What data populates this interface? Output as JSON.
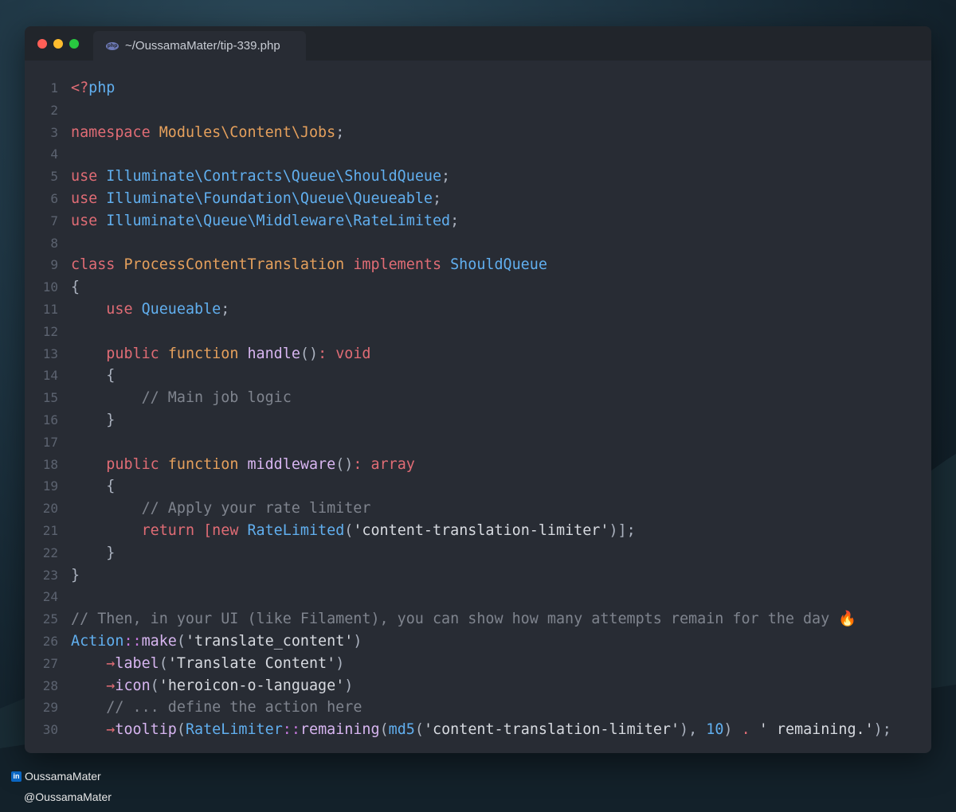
{
  "window": {
    "tab_title": "~/OussamaMater/tip-339.php",
    "tab_icon": "php-file-icon"
  },
  "code_lines": [
    {
      "n": "1",
      "tokens": [
        [
          "kw",
          "<?"
        ],
        [
          "ns",
          "php"
        ]
      ]
    },
    {
      "n": "2",
      "tokens": []
    },
    {
      "n": "3",
      "tokens": [
        [
          "kw",
          "namespace "
        ],
        [
          "cls",
          "Modules\\Content\\Jobs"
        ],
        [
          "pun",
          ";"
        ]
      ]
    },
    {
      "n": "4",
      "tokens": []
    },
    {
      "n": "5",
      "tokens": [
        [
          "kw",
          "use "
        ],
        [
          "ns",
          "Illuminate\\Contracts\\Queue\\ShouldQueue"
        ],
        [
          "pun",
          ";"
        ]
      ]
    },
    {
      "n": "6",
      "tokens": [
        [
          "kw",
          "use "
        ],
        [
          "ns",
          "Illuminate\\Foundation\\Queue\\Queueable"
        ],
        [
          "pun",
          ";"
        ]
      ]
    },
    {
      "n": "7",
      "tokens": [
        [
          "kw",
          "use "
        ],
        [
          "ns",
          "Illuminate\\Queue\\Middleware\\RateLimited"
        ],
        [
          "pun",
          ";"
        ]
      ]
    },
    {
      "n": "8",
      "tokens": []
    },
    {
      "n": "9",
      "tokens": [
        [
          "kw",
          "class "
        ],
        [
          "cls",
          "ProcessContentTranslation "
        ],
        [
          "kw",
          "implements "
        ],
        [
          "ns",
          "ShouldQueue"
        ]
      ]
    },
    {
      "n": "10",
      "tokens": [
        [
          "pun",
          "{"
        ]
      ]
    },
    {
      "n": "11",
      "tokens": [
        [
          "pun",
          "    "
        ],
        [
          "kw",
          "use "
        ],
        [
          "ns",
          "Queueable"
        ],
        [
          "pun",
          ";"
        ]
      ]
    },
    {
      "n": "12",
      "tokens": []
    },
    {
      "n": "13",
      "tokens": [
        [
          "pun",
          "    "
        ],
        [
          "kw",
          "public "
        ],
        [
          "cls",
          "function "
        ],
        [
          "fn",
          "handle"
        ],
        [
          "pun",
          "()"
        ],
        [
          "kw",
          ": void"
        ]
      ]
    },
    {
      "n": "14",
      "tokens": [
        [
          "pun",
          "    {"
        ]
      ]
    },
    {
      "n": "15",
      "tokens": [
        [
          "pun",
          "        "
        ],
        [
          "cm",
          "// Main job logic"
        ]
      ]
    },
    {
      "n": "16",
      "tokens": [
        [
          "pun",
          "    }"
        ]
      ]
    },
    {
      "n": "17",
      "tokens": []
    },
    {
      "n": "18",
      "tokens": [
        [
          "pun",
          "    "
        ],
        [
          "kw",
          "public "
        ],
        [
          "cls",
          "function "
        ],
        [
          "fn",
          "middleware"
        ],
        [
          "pun",
          "()"
        ],
        [
          "kw",
          ": array"
        ]
      ]
    },
    {
      "n": "19",
      "tokens": [
        [
          "pun",
          "    {"
        ]
      ]
    },
    {
      "n": "20",
      "tokens": [
        [
          "pun",
          "        "
        ],
        [
          "cm",
          "// Apply your rate limiter"
        ]
      ]
    },
    {
      "n": "21",
      "tokens": [
        [
          "pun",
          "        "
        ],
        [
          "kw",
          "return "
        ],
        [
          "kw",
          "["
        ],
        [
          "kw",
          "new "
        ],
        [
          "ns",
          "RateLimited"
        ],
        [
          "pun",
          "("
        ],
        [
          "str",
          "'content-translation-limiter'"
        ],
        [
          "pun",
          ")];"
        ]
      ]
    },
    {
      "n": "22",
      "tokens": [
        [
          "pun",
          "    }"
        ]
      ]
    },
    {
      "n": "23",
      "tokens": [
        [
          "pun",
          "}"
        ]
      ]
    },
    {
      "n": "24",
      "tokens": []
    },
    {
      "n": "25",
      "tokens": [
        [
          "cm",
          "// Then, in your UI (like Filament), you can show how many attempts remain for the day "
        ],
        [
          "fire",
          "🔥"
        ]
      ]
    },
    {
      "n": "26",
      "tokens": [
        [
          "ns",
          "Action"
        ],
        [
          "op",
          "::"
        ],
        [
          "fn",
          "make"
        ],
        [
          "pun",
          "("
        ],
        [
          "str",
          "'translate_content'"
        ],
        [
          "pun",
          ")"
        ]
      ]
    },
    {
      "n": "27",
      "tokens": [
        [
          "pun",
          "    "
        ],
        [
          "kw",
          "→"
        ],
        [
          "fn",
          "label"
        ],
        [
          "pun",
          "("
        ],
        [
          "str",
          "'Translate Content'"
        ],
        [
          "pun",
          ")"
        ]
      ]
    },
    {
      "n": "28",
      "tokens": [
        [
          "pun",
          "    "
        ],
        [
          "kw",
          "→"
        ],
        [
          "fn",
          "icon"
        ],
        [
          "pun",
          "("
        ],
        [
          "str",
          "'heroicon-o-language'"
        ],
        [
          "pun",
          ")"
        ]
      ]
    },
    {
      "n": "29",
      "tokens": [
        [
          "pun",
          "    "
        ],
        [
          "cm",
          "// ... define the action here"
        ]
      ]
    },
    {
      "n": "30",
      "tokens": [
        [
          "pun",
          "    "
        ],
        [
          "kw",
          "→"
        ],
        [
          "fn",
          "tooltip"
        ],
        [
          "pun",
          "("
        ],
        [
          "ns",
          "RateLimiter"
        ],
        [
          "op",
          "::"
        ],
        [
          "fn",
          "remaining"
        ],
        [
          "pun",
          "("
        ],
        [
          "ns",
          "md5"
        ],
        [
          "pun",
          "("
        ],
        [
          "str",
          "'content-translation-limiter'"
        ],
        [
          "pun",
          "), "
        ],
        [
          "num",
          "10"
        ],
        [
          "pun",
          ") "
        ],
        [
          "kw",
          ". "
        ],
        [
          "str",
          "' remaining.'"
        ],
        [
          "pun",
          ");"
        ]
      ]
    }
  ],
  "credits": {
    "linkedin_icon": "linkedin-icon",
    "linkedin_handle": "OussamaMater",
    "x_icon": "x-icon",
    "x_handle": "@OussamaMater"
  },
  "colors": {
    "editor_bg": "#282c34",
    "titlebar_bg": "#21252b",
    "keyword": "#e06c75",
    "class": "#e5a05c",
    "namespace": "#61afef",
    "function": "#d7b5f0",
    "comment": "#7f848e"
  }
}
